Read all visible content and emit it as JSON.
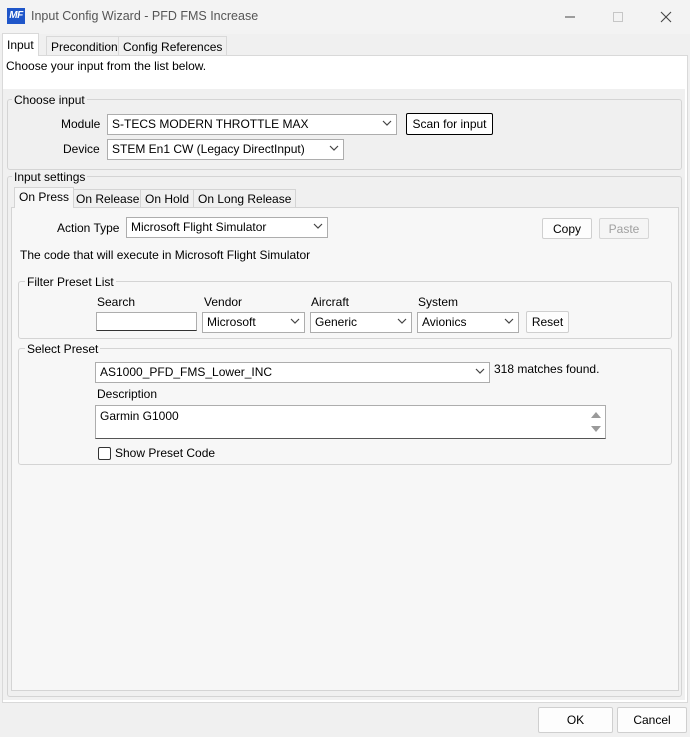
{
  "window": {
    "logo_text": "MF",
    "title": "Input Config Wizard - PFD FMS Increase"
  },
  "tabs": [
    {
      "label": "Input"
    },
    {
      "label": "Precondition"
    },
    {
      "label": "Config References"
    }
  ],
  "instruction": "Choose your input from the list below.",
  "choose_input": {
    "group_label": "Choose input",
    "module_label": "Module",
    "module_value": "S-TECS MODERN THROTTLE MAX",
    "scan_button": "Scan for input",
    "device_label": "Device",
    "device_value": "STEM En1 CW (Legacy DirectInput)"
  },
  "input_settings": {
    "group_label": "Input settings",
    "tabs": [
      {
        "label": "On Press"
      },
      {
        "label": "On Release"
      },
      {
        "label": "On Hold"
      },
      {
        "label": "On Long Release"
      }
    ],
    "action_type_label": "Action Type",
    "action_type_value": "Microsoft Flight Simulator",
    "copy_button": "Copy",
    "paste_button": "Paste",
    "code_info": "The code that will execute in Microsoft Flight Simulator"
  },
  "filter": {
    "group_label": "Filter Preset List",
    "search_label": "Search",
    "search_value": "",
    "vendor_label": "Vendor",
    "vendor_value": "Microsoft",
    "aircraft_label": "Aircraft",
    "aircraft_value": "Generic",
    "system_label": "System",
    "system_value": "Avionics",
    "reset_button": "Reset"
  },
  "preset": {
    "group_label": "Select Preset",
    "preset_value": "AS1000_PFD_FMS_Lower_INC",
    "matches": "318 matches found.",
    "description_label": "Description",
    "description_value": "Garmin G1000",
    "show_code_label": "Show Preset Code",
    "show_code_checked": false
  },
  "footer": {
    "ok_button": "OK",
    "cancel_button": "Cancel"
  }
}
